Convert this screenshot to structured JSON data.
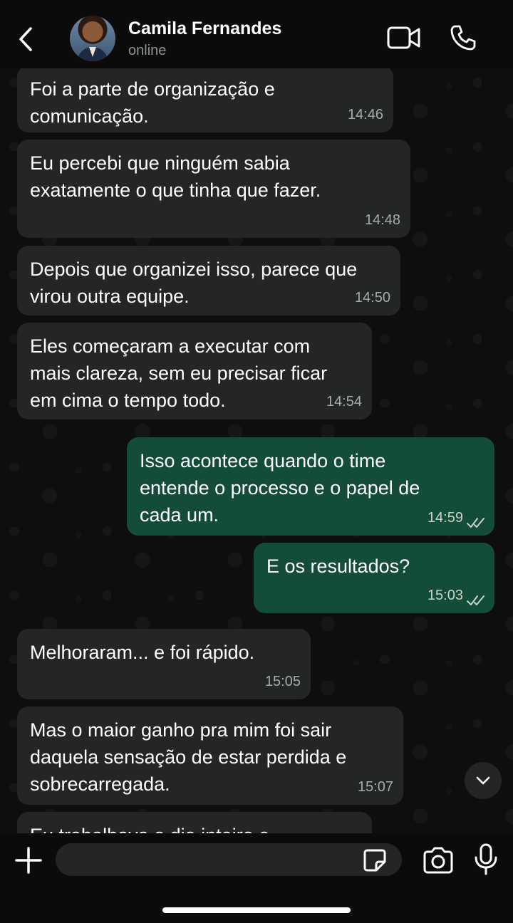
{
  "header": {
    "contact_name": "Camila Fernandes",
    "status": "online"
  },
  "messages": [
    {
      "direction": "in",
      "text": "Foi a parte de organização e\ncomunicação.",
      "time": "14:46"
    },
    {
      "direction": "in",
      "text": "Eu percebi que ninguém sabia\nexatamente o que tinha que fazer.",
      "time": "14:48"
    },
    {
      "direction": "in",
      "text": "Depois que organizei isso, parece que\nvirou outra equipe.",
      "time": "14:50"
    },
    {
      "direction": "in",
      "text": "Eles começaram a executar com\nmais clareza, sem eu precisar ficar\nem cima o tempo todo.",
      "time": "14:54"
    },
    {
      "direction": "out",
      "text": "Isso acontece quando o time\nentende o processo e o papel de\ncada um.",
      "time": "14:59",
      "status": "read"
    },
    {
      "direction": "out",
      "text": "E os resultados?",
      "time": "15:03",
      "status": "read"
    },
    {
      "direction": "in",
      "text": "Melhoraram... e foi rápido.",
      "time": "15:05"
    },
    {
      "direction": "in",
      "text": "Mas o maior ganho pra mim foi sair\ndaquela sensação de estar perdida e\nsobrecarregada.",
      "time": "15:07"
    },
    {
      "direction": "in",
      "text": "Eu trabalhava o dia inteiro e",
      "time": ""
    }
  ],
  "composer": {
    "input_value": "",
    "input_placeholder": ""
  },
  "icons": {
    "back": "chevron-left-icon",
    "video": "video-camera-icon",
    "call": "phone-icon",
    "scroll": "chevron-down-icon",
    "plus": "plus-icon",
    "sticker": "sticker-icon",
    "camera": "camera-icon",
    "mic": "microphone-icon",
    "read_ticks": "double-check-icon"
  },
  "colors": {
    "incoming_bubble": "#242626",
    "outgoing_bubble": "#144d37",
    "background": "#0b0b0b"
  }
}
